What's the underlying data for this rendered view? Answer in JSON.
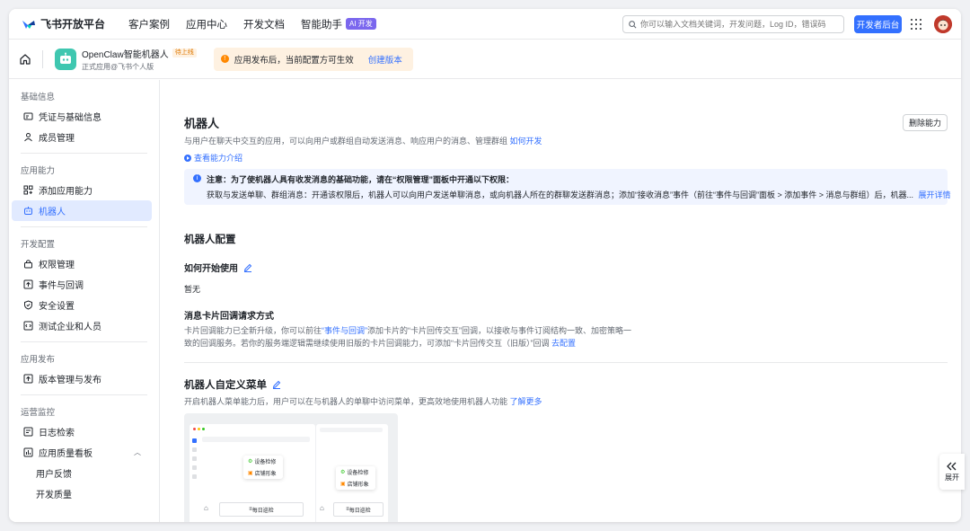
{
  "topbar": {
    "brand": "飞书开放平台",
    "nav": [
      "客户案例",
      "应用中心",
      "开发文档",
      "智能助手"
    ],
    "ai_badge": "AI 开发",
    "search_placeholder": "你可以输入文档关键词，开发问题，Log ID，错误码",
    "dev_console": "开发者后台",
    "accent": "#3370ff"
  },
  "app": {
    "name": "OpenClaw智能机器人",
    "status": "待上线",
    "subtitle": "正式应用@飞书个人版",
    "notice": "应用发布后，当前配置方可生效",
    "notice_action": "创建版本"
  },
  "sidebar": {
    "groups": [
      {
        "title": "基础信息",
        "items": [
          {
            "label": "凭证与基础信息",
            "icon": "credential-icon"
          },
          {
            "label": "成员管理",
            "icon": "member-icon"
          }
        ]
      },
      {
        "title": "应用能力",
        "items": [
          {
            "label": "添加应用能力",
            "icon": "add-capability-icon"
          },
          {
            "label": "机器人",
            "icon": "robot-icon",
            "active": true
          }
        ]
      },
      {
        "title": "开发配置",
        "items": [
          {
            "label": "权限管理",
            "icon": "permission-icon"
          },
          {
            "label": "事件与回调",
            "icon": "event-icon"
          },
          {
            "label": "安全设置",
            "icon": "security-icon"
          },
          {
            "label": "测试企业和人员",
            "icon": "test-icon"
          }
        ]
      },
      {
        "title": "应用发布",
        "items": [
          {
            "label": "版本管理与发布",
            "icon": "version-icon"
          }
        ]
      },
      {
        "title": "运营监控",
        "items": [
          {
            "label": "日志检索",
            "icon": "log-icon"
          },
          {
            "label": "应用质量看板",
            "icon": "dashboard-icon"
          }
        ],
        "subitems": [
          "用户反馈",
          "开发质量"
        ]
      }
    ]
  },
  "main": {
    "title": "机器人",
    "desc": "与用户在聊天中交互的应用，可以向用户或群组自动发送消息、响应用户的消息、管理群组",
    "desc_link": "如何开发",
    "intro_link": "查看能力介绍",
    "delete_btn": "删除能力",
    "alert_title": "注意：为了使机器人具有收发消息的基础功能，请在“权限管理”面板中开通以下权限：",
    "alert_body": "获取与发送单聊、群组消息：开通该权限后，机器人可以向用户发送单聊消息，或向机器人所在的群聊发送群消息；添加“接收消息”事件（前往“事件与回调”面板 > 添加事件 > 消息与群组）后，机器...",
    "alert_link": "展开详情",
    "config_title": "机器人配置",
    "how_to_start": "如何开始使用",
    "none_text": "暂无",
    "card_title": "消息卡片回调请求方式",
    "card_desc_1a": "卡片回调能力已全新升级，你可以前往",
    "card_desc_link1": "“事件与回调”",
    "card_desc_1b": "添加卡片的“卡片回传交互”回调，以接收与事件订阅结构一致、加密策略一",
    "card_desc_2": "致的回调服务。若你的服务端逻辑需继续使用旧版的卡片回调能力，可添加“卡片回传交互（旧版）”回调",
    "card_desc_link2": "去配置",
    "menu_title": "机器人自定义菜单",
    "menu_desc": "开启机器人菜单能力后，用户可以在与机器人的单聊中访问菜单，更高效地使用机器人功能",
    "menu_link": "了解更多",
    "preview": {
      "menu_a": "设备检修",
      "menu_b": "店铺形象",
      "bar_label": "每日巡检"
    }
  },
  "expand_label": "展开"
}
